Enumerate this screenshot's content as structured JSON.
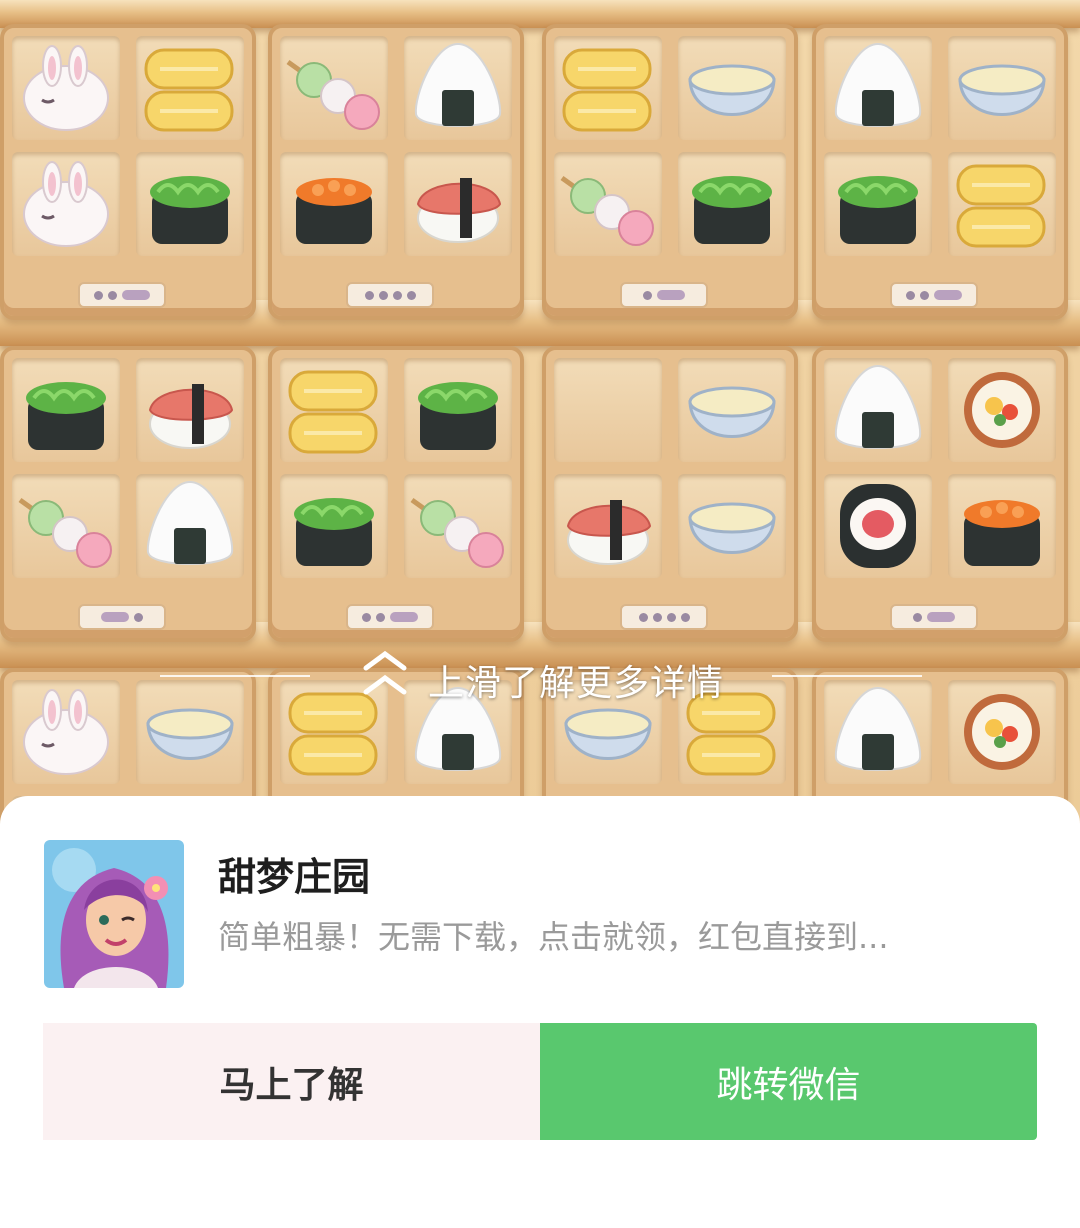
{
  "background": {
    "theme": "sushi-shelf-game",
    "food_icons": [
      "bunny-mochi-icon",
      "tamagoyaki-icon",
      "dango-icon",
      "onigiri-icon",
      "ikura-gunkan-icon",
      "seaweed-gunkan-icon",
      "nigiri-icon",
      "custard-bowl-icon",
      "maki-roll-icon",
      "futomaki-icon"
    ]
  },
  "hint": {
    "text": "上滑了解更多详情"
  },
  "app": {
    "name": "甜梦庄园",
    "description": "简单粗暴！无需下载，点击就领，红包直接到..."
  },
  "buttons": {
    "learn_label": "马上了解",
    "wechat_label": "跳转微信",
    "wechat_color": "#59c86e",
    "learn_color": "#fbf1f2"
  }
}
